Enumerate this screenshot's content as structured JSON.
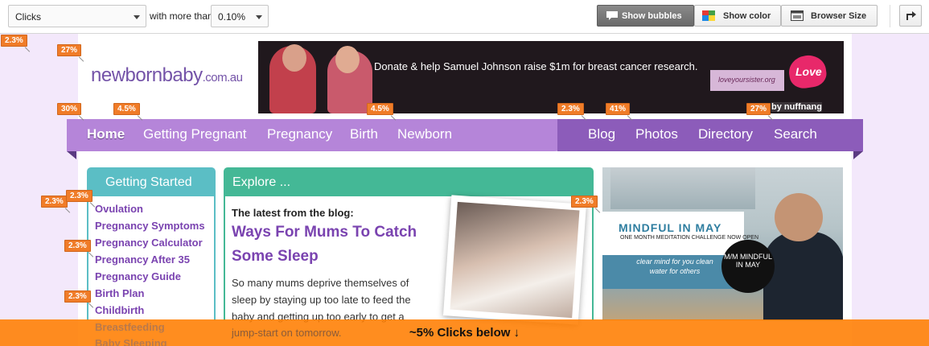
{
  "toolbar": {
    "metric_select": "Clicks",
    "with_more_than": "with more than:",
    "threshold_select": "0.10%",
    "show_bubbles": "Show bubbles",
    "show_color": "Show color",
    "browser_size": "Browser Size",
    "active_button": "Show bubbles"
  },
  "site": {
    "logo_main": "newbornbaby",
    "logo_tld": ".com.au",
    "banner_text": "Donate & help Samuel Johnson raise $1m for breast cancer research.",
    "banner_love_box": "loveyoursister.org",
    "banner_love": "Love",
    "banner_by": "by nuffnang"
  },
  "nav": {
    "left": [
      "Home",
      "Getting Pregnant",
      "Pregnancy",
      "Birth",
      "Newborn"
    ],
    "right": [
      "Blog",
      "Photos",
      "Directory",
      "Search"
    ]
  },
  "getting_started": {
    "title": "Getting Started",
    "items": [
      "Ovulation",
      "Pregnancy Symptoms",
      "Pregnancy Calculator",
      "Pregnancy After 35",
      "Pregnancy Guide",
      "Birth Plan",
      "Childbirth"
    ],
    "faded_items": [
      "Breastfeeding",
      "Baby Sleeping"
    ]
  },
  "explore": {
    "title": "Explore ...",
    "latest_label": "The latest from the blog:",
    "headline": "Ways For Mums To Catch Some Sleep",
    "excerpt": "So many mums deprive themselves of sleep by staying up too late to feed the baby and getting up too early to get a",
    "excerpt_faded": "jump-start on tomorrow."
  },
  "ad": {
    "title": "MINDFUL IN MAY",
    "subtitle": "ONE MONTH MEDITATION CHALLENGE NOW OPEN",
    "tagline": "clear mind for you clean water for others",
    "circle_text": "M/M MINDFUL IN MAY"
  },
  "bubbles": [
    "2.3%",
    "27%",
    "30%",
    "4.5%",
    "4.5%",
    "2.3%",
    "41%",
    "27%",
    "2.3%",
    "2.3%",
    "2.3%",
    "2.3%",
    "2.3%"
  ],
  "below_fold": "~5% Clicks below ↓",
  "colors": {
    "nav_light": "#b585d9",
    "nav_dark": "#8c5cba",
    "bubble": "#f07c28",
    "teal": "#5bbec5",
    "green": "#44b896"
  }
}
